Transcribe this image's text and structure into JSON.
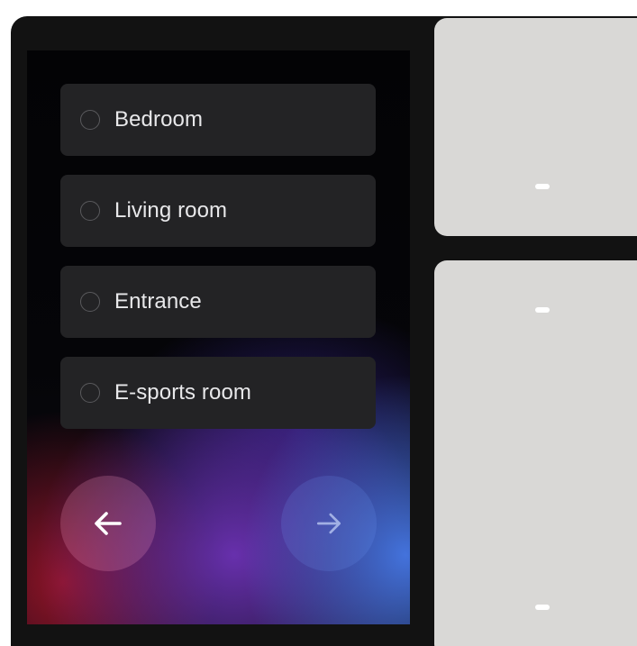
{
  "rooms": [
    {
      "label": "Bedroom",
      "selected": false
    },
    {
      "label": "Living room",
      "selected": false
    },
    {
      "label": "Entrance",
      "selected": false
    },
    {
      "label": "E-sports room",
      "selected": false
    }
  ],
  "navigation": {
    "prev_icon": "arrow-left-icon",
    "next_icon": "arrow-right-icon",
    "next_enabled": false
  },
  "switch_panels": {
    "top": {
      "indicator_icon": "indicator-light"
    },
    "bottom": {
      "indicator_icon": "indicator-light",
      "indicator_count": 2
    }
  },
  "colors": {
    "frame": "#121212",
    "item_background": "#232325",
    "item_text": "#e8e8ea",
    "panel": "#d9d8d6",
    "indicator": "#ffffff"
  }
}
